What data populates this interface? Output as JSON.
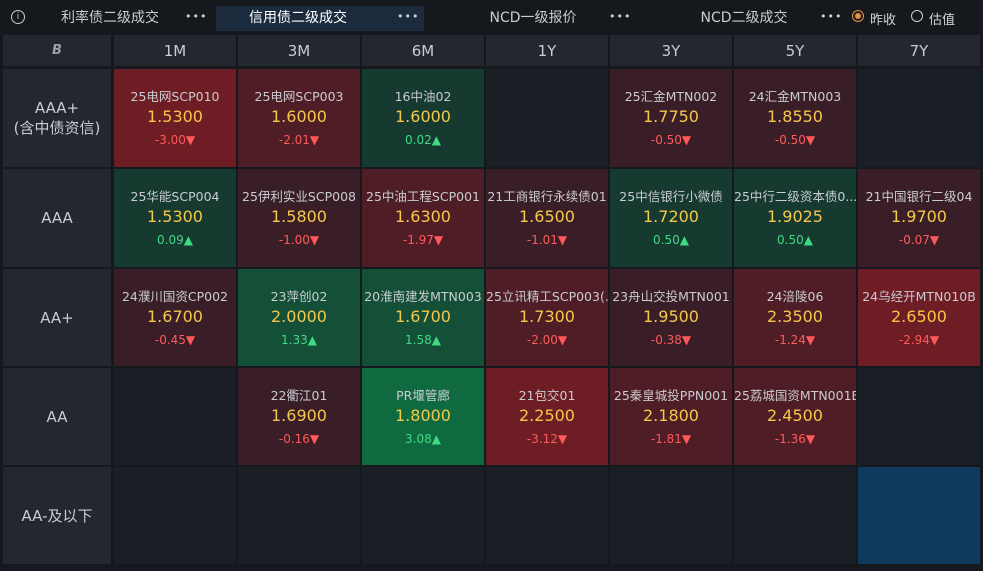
{
  "tabs": [
    {
      "label": "利率债二级成交",
      "active": false
    },
    {
      "label": "信用债二级成交",
      "active": true
    },
    {
      "label": "NCD一级报价",
      "active": false
    },
    {
      "label": "NCD二级成交",
      "active": false
    }
  ],
  "info_icon": "i",
  "more_label": "•••",
  "radios": [
    {
      "label": "昨收",
      "selected": true
    },
    {
      "label": "估值",
      "selected": false
    }
  ],
  "corner_logo": "B",
  "columns": [
    "1M",
    "3M",
    "6M",
    "1Y",
    "3Y",
    "5Y",
    "7Y"
  ],
  "rows": [
    {
      "label": "AAA+",
      "label2": "(含中债资信)",
      "cells": [
        {
          "name": "25电网SCP010",
          "price": "1.5300",
          "change": "-3.00▼",
          "dir": "down",
          "tone": "red3"
        },
        {
          "name": "25电网SCP003",
          "price": "1.6000",
          "change": "-2.01▼",
          "dir": "down",
          "tone": "red2"
        },
        {
          "name": "16中油02",
          "price": "1.6000",
          "change": "0.02▲",
          "dir": "up",
          "tone": "green1"
        },
        null,
        {
          "name": "25汇金MTN002",
          "price": "1.7750",
          "change": "-0.50▼",
          "dir": "down",
          "tone": "red1"
        },
        {
          "name": "24汇金MTN003",
          "price": "1.8550",
          "change": "-0.50▼",
          "dir": "down",
          "tone": "red1"
        },
        null
      ]
    },
    {
      "label": "AAA",
      "label2": "",
      "cells": [
        {
          "name": "25华能SCP004",
          "price": "1.5300",
          "change": "0.09▲",
          "dir": "up",
          "tone": "green1"
        },
        {
          "name": "25伊利实业SCP008",
          "price": "1.5800",
          "change": "-1.00▼",
          "dir": "down",
          "tone": "red1"
        },
        {
          "name": "25中油工程SCP001",
          "price": "1.6300",
          "change": "-1.97▼",
          "dir": "down",
          "tone": "red2"
        },
        {
          "name": "21工商银行永续债01",
          "price": "1.6500",
          "change": "-1.01▼",
          "dir": "down",
          "tone": "red1"
        },
        {
          "name": "25中信银行小微债",
          "price": "1.7200",
          "change": "0.50▲",
          "dir": "up",
          "tone": "green1"
        },
        {
          "name": "25中行二级资本债0...",
          "price": "1.9025",
          "change": "0.50▲",
          "dir": "up",
          "tone": "green1"
        },
        {
          "name": "21中国银行二级04",
          "price": "1.9700",
          "change": "-0.07▼",
          "dir": "down",
          "tone": "red1"
        }
      ]
    },
    {
      "label": "AA+",
      "label2": "",
      "cells": [
        {
          "name": "24濮川国资CP002",
          "price": "1.6700",
          "change": "-0.45▼",
          "dir": "down",
          "tone": "red1"
        },
        {
          "name": "23萍创02",
          "price": "2.0000",
          "change": "1.33▲",
          "dir": "up",
          "tone": "green2"
        },
        {
          "name": "20淮南建发MTN003",
          "price": "1.6700",
          "change": "1.58▲",
          "dir": "up",
          "tone": "green2"
        },
        {
          "name": "25立讯精工SCP003(...",
          "price": "1.7300",
          "change": "-2.00▼",
          "dir": "down",
          "tone": "red2"
        },
        {
          "name": "23舟山交投MTN001",
          "price": "1.9500",
          "change": "-0.38▼",
          "dir": "down",
          "tone": "red1"
        },
        {
          "name": "24涪陵06",
          "price": "2.3500",
          "change": "-1.24▼",
          "dir": "down",
          "tone": "red2"
        },
        {
          "name": "24乌经开MTN010B",
          "price": "2.6500",
          "change": "-2.94▼",
          "dir": "down",
          "tone": "red3"
        }
      ]
    },
    {
      "label": "AA",
      "label2": "",
      "cells": [
        null,
        {
          "name": "22衢江01",
          "price": "1.6900",
          "change": "-0.16▼",
          "dir": "down",
          "tone": "red1"
        },
        {
          "name": "PR堰管廊",
          "price": "1.8000",
          "change": "3.08▲",
          "dir": "up",
          "tone": "green3"
        },
        {
          "name": "21包交01",
          "price": "2.2500",
          "change": "-3.12▼",
          "dir": "down",
          "tone": "red3"
        },
        {
          "name": "25秦皇城投PPN001",
          "price": "2.1800",
          "change": "-1.81▼",
          "dir": "down",
          "tone": "red2"
        },
        {
          "name": "25荔城国资MTN001B",
          "price": "2.4500",
          "change": "-1.36▼",
          "dir": "down",
          "tone": "red2"
        },
        null
      ]
    },
    {
      "label": "AA-及以下",
      "label2": "",
      "cells": [
        null,
        null,
        null,
        null,
        null,
        null,
        {
          "name": "",
          "price": "",
          "change": "",
          "dir": "",
          "tone": "blue"
        }
      ]
    }
  ],
  "colors": {
    "empty": "#1a1e25",
    "red1": "#3a1e27",
    "red2": "#4f1d25",
    "red3": "#6e1d24",
    "green1": "#163a30",
    "green2": "#145037",
    "green3": "#106a3f",
    "blue": "#0f3a5e",
    "price": "#f5c84b",
    "down": "#ff5a5a",
    "up": "#3ddc84"
  }
}
